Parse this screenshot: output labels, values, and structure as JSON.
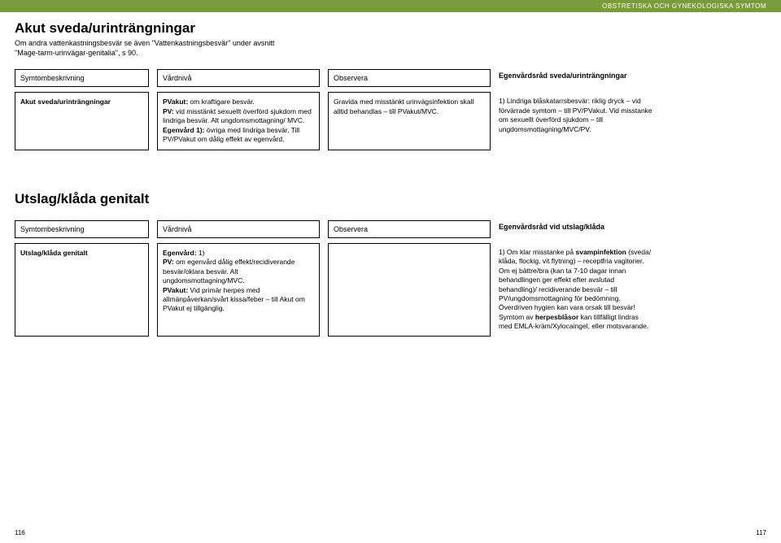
{
  "header_band": "OBSTRETISKA OCH GYNEKOLOGISKA SYMTOM",
  "section1": {
    "title": "Akut sveda/urinträngningar",
    "subtitle": "Om andra vattenkastningsbesvär se även \"Vattenkastningsbesvär\" under avsnitt \"Mage-tarm-urinvägar-genitalia\", s 90.",
    "headers": {
      "a": "Symtombeskrivning",
      "b": "Vårdnivå",
      "c": "Observera",
      "d": "Egenvårdsråd sveda/urinträngningar"
    },
    "row": {
      "a": "Akut sveda/urinträngningar",
      "b_line1_b": "PVakut:",
      "b_line1_r": " om kraftigare besvär.",
      "b_line2_b": "PV:",
      "b_line2_r": " vid misstänkt sexuellt överförd sjukdom med lindriga besvär. Alt ungdomsmottagning/ MVC.",
      "b_line3_b": "Egenvård 1):",
      "b_line3_r": " övriga med lindriga besvär. Till PV/PVakut om dålig effekt av egenvård.",
      "c": "Gravida med misstänkt urinvägsinfektion skall alltid behandlas – till PVakut/MVC.",
      "d": "1) Lindriga blåskatarrsbesvär: riklig dryck – vid förvärrade symtom – till PV/PVakut. Vid misstanke om sexuellt överförd sjukdom – till ungdomsmottagning/MVC/PV."
    }
  },
  "section2": {
    "title": "Utslag/klåda genitalt",
    "headers": {
      "a": "Symtombeskrivning",
      "b": "Vårdnivå",
      "c": "Observera",
      "d": "Egenvårdsråd vid utslag/klåda"
    },
    "row": {
      "a": "Utslag/klåda genitalt",
      "b_line1_b": "Egenvård:",
      "b_line1_r": " 1)",
      "b_line2_b": "PV:",
      "b_line2_r": " om egenvård dålig effekt/recidiverande besvär/oklara besvär. Alt ungdomsmottagning/MVC.",
      "b_line3_b": "PVakut:",
      "b_line3_r": " Vid primär herpes med allmänpåverkan/svårt kissa/feber – till Akut om PVakut ej tillgänglig.",
      "c": "",
      "d_p1a": "1) Om klar misstanke på ",
      "d_p1b": "svampinfektion",
      "d_p1c": " (sveda/ klåda, flockig, vit flytning) – receptfria vagitorier. Om ej bättre/bra (kan ta 7-10 dagar innan behandlingen ger effekt efter avslutad behandling)/ recidiverande besvär – till PV/ungdomsmottagning för bedömning.",
      "d_p2": "Överdriven hygien kan vara orsak till besvär!",
      "d_p3a": "Symtom av ",
      "d_p3b": "herpesblåsor",
      "d_p3c": " kan tillfälligt lindras med EMLA-kräm/Xylocaingel, eller motsvarande."
    }
  },
  "footer": {
    "left": "116",
    "right": "117"
  }
}
